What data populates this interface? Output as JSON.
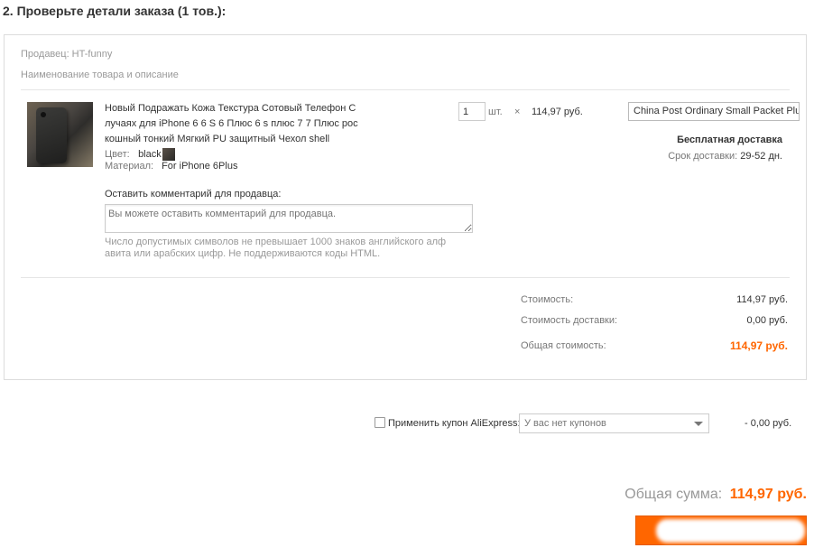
{
  "section": {
    "title": "2. Проверьте детали заказа (1 тов.):"
  },
  "order": {
    "seller_label": "Продавец: HT-funny",
    "column_header": "Наименование товара и описание",
    "product": {
      "title": "Новый Подражать Кожа Текстура Сотовый Телефон С лучаях для iPhone 6 6 S 6 Плюс 6 s плюс 7 7 Плюс рос кошный тонкий Мягкий PU защитный Чехол shell",
      "color_label": "Цвет:",
      "color_value": "black",
      "material_label": "Материал:",
      "material_value": "For iPhone 6Plus",
      "quantity": "1",
      "qty_unit": "шт.",
      "times": "×",
      "unit_price": "114,97 руб.",
      "shipping_method": "China Post Ordinary Small Packet Plus",
      "free_shipping": "Бесплатная доставка",
      "delivery_label": "Срок доставки:",
      "delivery_value": "29-52 дн."
    },
    "comment": {
      "label": "Оставить комментарий для продавца:",
      "placeholder": "Вы можете оставить комментарий для продавца.",
      "hint": "Число допустимых символов не превышает 1000 знаков английского алф авита или арабских цифр. Не поддерживаются коды HTML."
    },
    "summary": {
      "cost_label": "Стоимость:",
      "cost_value": "114,97 руб.",
      "shipping_label": "Стоимость доставки:",
      "shipping_value": "0,00 руб.",
      "total_label": "Общая стоимость:",
      "total_value": "114,97 руб."
    }
  },
  "coupon": {
    "checked": false,
    "label": "Применить купон AliExpress:",
    "selected": "У вас нет купонов",
    "discount": "- 0,00 руб."
  },
  "grand_total": {
    "label": "Общая сумма:",
    "amount": "114,97 руб."
  },
  "colors": {
    "accent": "#ff6600",
    "border": "#dcdcdc",
    "muted_text": "#999999"
  },
  "icons": [
    "product-image",
    "color-swatch",
    "chevron-down-icon",
    "checkbox"
  ]
}
